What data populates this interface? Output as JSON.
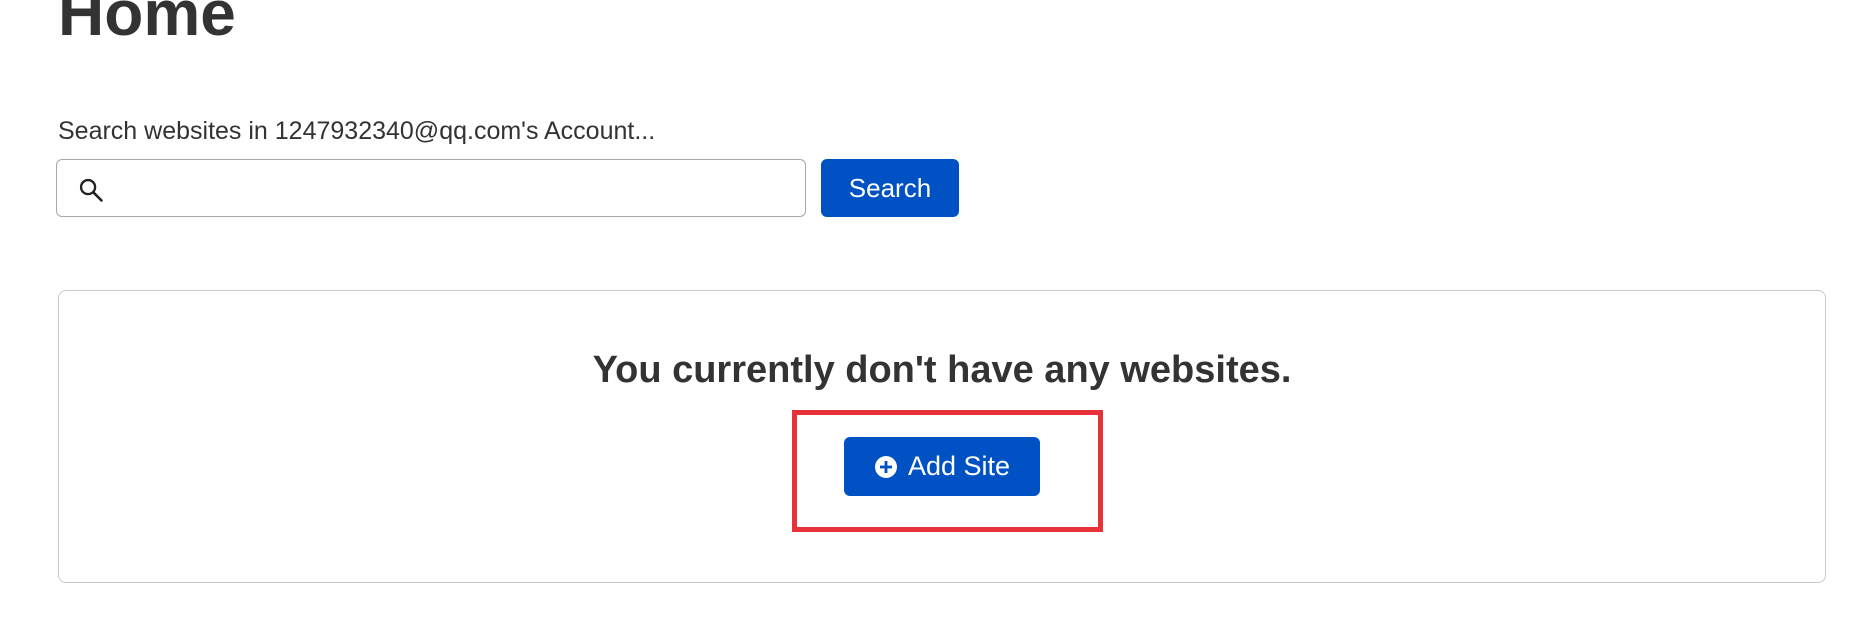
{
  "page": {
    "title": "Home"
  },
  "search": {
    "label": "Search websites in 1247932340@qq.com's Account...",
    "value": "",
    "placeholder": "",
    "button_label": "Search",
    "icon": "search-icon"
  },
  "empty_state": {
    "message": "You currently don't have any websites.",
    "add_button_label": "Add Site",
    "add_button_icon": "plus-circle-icon"
  },
  "colors": {
    "primary": "#0051c3",
    "highlight": "#e8323a",
    "text": "#333333"
  }
}
